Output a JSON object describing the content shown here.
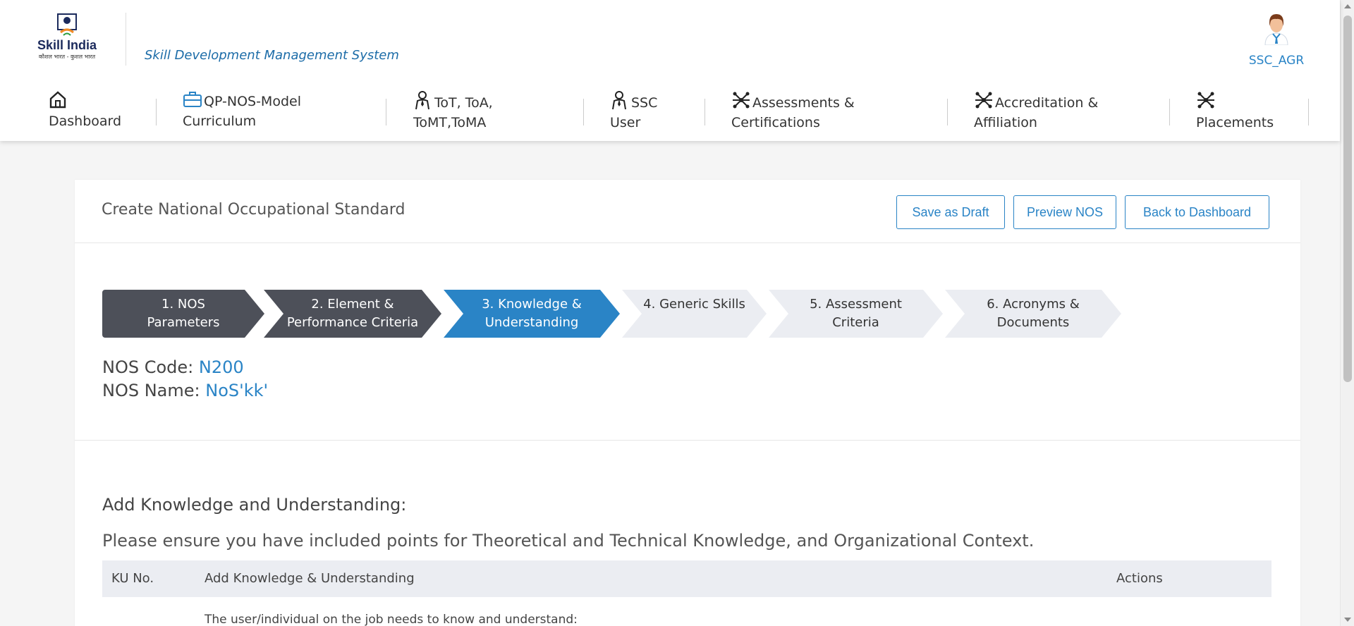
{
  "header": {
    "logo": {
      "name": "Skill India",
      "tagline": "कौशल भारत - कुशल भारत"
    },
    "app_title": "Skill Development Management System",
    "user": {
      "name": "SSC_AGR"
    }
  },
  "nav": {
    "items": [
      {
        "label": "Dashboard",
        "icon": "home-icon"
      },
      {
        "label": "QP-NOS-Model Curriculum",
        "icon": "briefcase-icon"
      },
      {
        "label": "ToT, ToA, ToMT,ToMA",
        "icon": "trainer-icon"
      },
      {
        "label": "SSC User",
        "icon": "user-icon"
      },
      {
        "label": "Assessments & Certifications",
        "icon": "network-icon"
      },
      {
        "label": "Accreditation & Affiliation",
        "icon": "network-icon"
      },
      {
        "label": "Placements",
        "icon": "network-icon"
      }
    ]
  },
  "card": {
    "title": "Create National Occupational Standard",
    "buttons": {
      "save_draft": "Save as Draft",
      "preview": "Preview NOS",
      "back": "Back to Dashboard"
    }
  },
  "steps": [
    {
      "label": "1. NOS Parameters",
      "state": "done"
    },
    {
      "label": "2. Element & Performance Criteria",
      "state": "done"
    },
    {
      "label": "3. Knowledge & Understanding",
      "state": "active"
    },
    {
      "label": "4. Generic Skills",
      "state": "todo"
    },
    {
      "label": "5. Assessment Criteria",
      "state": "todo"
    },
    {
      "label": "6. Acronyms & Documents",
      "state": "todo"
    }
  ],
  "nos": {
    "code_label": "NOS Code:",
    "code": "N200",
    "name_label": "NOS Name:",
    "name": "NoS'kk'"
  },
  "ku": {
    "title": "Add Knowledge and Understanding:",
    "note": "Please ensure you have included points for Theoretical and Technical Knowledge, and Organizational Context.",
    "table": {
      "headers": [
        "KU No.",
        "Add Knowledge & Understanding",
        "Actions"
      ],
      "first_row_text": "The user/individual on the job needs to know and understand:"
    }
  },
  "colors": {
    "primary": "#2a84c6",
    "step_done": "#4d5059",
    "step_todo": "#ebedf2"
  }
}
